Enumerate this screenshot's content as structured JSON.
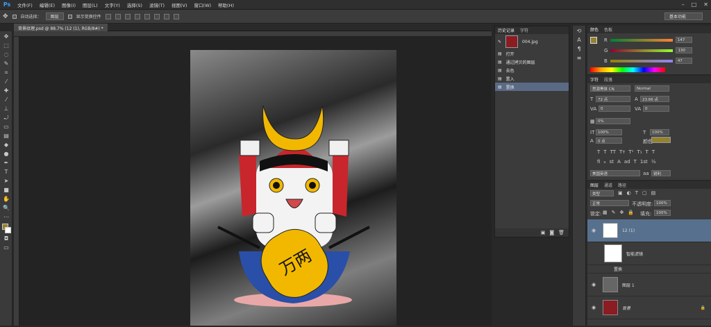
{
  "app": {
    "logo": "Ps"
  },
  "menu": [
    "文件(F)",
    "编辑(E)",
    "图像(I)",
    "图层(L)",
    "文字(Y)",
    "选择(S)",
    "滤镜(T)",
    "视图(V)",
    "窗口(W)",
    "帮助(H)"
  ],
  "options": {
    "auto_select_label": "自动选择：",
    "auto_select_value": "图层",
    "transform_label": "显示变换控件",
    "workspace": "基本功能"
  },
  "document": {
    "tab_title": "背景纹理.psd @ 88.7% (12 (1), RGB/8#) *"
  },
  "history": {
    "tabs": [
      "历史记录",
      "字符"
    ],
    "snapshot": "004.jpg",
    "items": [
      "打开",
      "通过拷贝的图层",
      "去色",
      "置入",
      "置换"
    ]
  },
  "color": {
    "tabs": [
      "颜色",
      "色板"
    ],
    "r_label": "R",
    "g_label": "G",
    "b_label": "B",
    "r_value": "147",
    "g_value": "130",
    "b_value": "47",
    "fg": "#938230"
  },
  "character": {
    "tabs": [
      "字符",
      "段落"
    ],
    "font": "思源黑体 CN",
    "style": "Normal",
    "size": "72 点",
    "leading": "23.66 点",
    "kerning": "0",
    "tracking": "0",
    "scale": "0%",
    "vscale": "100%",
    "hscale": "100%",
    "baseline": "0 点",
    "color_label": "颜色:",
    "language": "美国英语",
    "antialias": "锐利"
  },
  "layers": {
    "tabs": [
      "图层",
      "通道",
      "路径"
    ],
    "filter": "类型",
    "blend": "正常",
    "opacity_label": "不透明度:",
    "opacity": "100%",
    "lock_label": "锁定:",
    "fill_label": "填充:",
    "fill": "100%",
    "rows": [
      {
        "name": "12 (1)"
      },
      {
        "name": "智能滤镜"
      },
      {
        "name": "置换"
      },
      {
        "name": "图层 1"
      },
      {
        "name": "背景"
      }
    ]
  }
}
